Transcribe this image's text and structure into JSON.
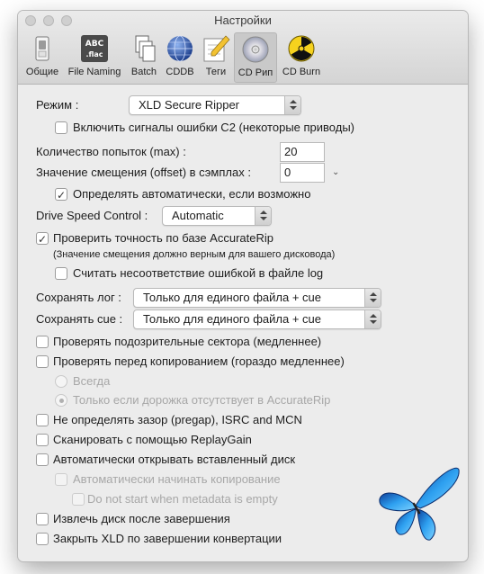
{
  "window": {
    "title": "Настройки"
  },
  "toolbar": [
    {
      "label": "Общие",
      "icon": "general-switch-icon"
    },
    {
      "label": "File Naming",
      "icon": "abc-flac-icon"
    },
    {
      "label": "Batch",
      "icon": "batch-documents-icon"
    },
    {
      "label": "CDDB",
      "icon": "globe-icon"
    },
    {
      "label": "Теги",
      "icon": "tag-pencil-icon"
    },
    {
      "label": "CD Рип",
      "icon": "cd-disc-icon",
      "selected": true
    },
    {
      "label": "CD Burn",
      "icon": "radiation-icon"
    }
  ],
  "ripper": {
    "mode_label": "Режим :",
    "mode_value": "XLD Secure Ripper",
    "c2_label": "Включить сигналы ошибки C2 (некоторые приводы)",
    "c2_checked": false,
    "retries_label": "Количество попыток (max) :",
    "retries_value": "20",
    "offset_label": "Значение смещения (offset) в сэмплах :",
    "offset_value": "0",
    "auto_offset_label": "Определять автоматически, если возможно",
    "auto_offset_checked": true,
    "drive_speed_label": "Drive Speed Control :",
    "drive_speed_value": "Automatic",
    "accuraterip_label": "Проверить точность по базе AccurateRip",
    "accuraterip_checked": true,
    "accuraterip_note": "(Значение смещения должно верным для вашего дисковода)",
    "mismatch_label": "Считать несоответствие ошибкой в файле log",
    "mismatch_checked": false,
    "save_log_label": "Сохранять лог :",
    "save_log_value": "Только для единого файла + cue",
    "save_cue_label": "Сохранять cue :",
    "save_cue_value": "Только для единого файла + cue",
    "suspicious_label": "Проверять подозрительные сектора (медленнее)",
    "verify_label": "Проверять перед копированием (гораздо медленнее)",
    "verify_always_label": "Всегда",
    "verify_missing_label": "Только если дорожка отсутствует в AccurateRip",
    "no_pregap_label": "Не определять зазор (pregap), ISRC and MCN",
    "replaygain_label": "Сканировать с помощью ReplayGain",
    "auto_open_label": "Автоматически открывать вставленный диск",
    "auto_start_label": "Автоматически начинать копирование",
    "no_metadata_label": "Do not start when metadata is empty",
    "eject_label": "Извлечь диск после завершения",
    "quit_label": "Закрыть XLD по завершении конвертации"
  },
  "colors": {
    "accent": "#3b8ef0",
    "window_bg": "#ececec",
    "disabled_text": "#a7a7a7"
  }
}
